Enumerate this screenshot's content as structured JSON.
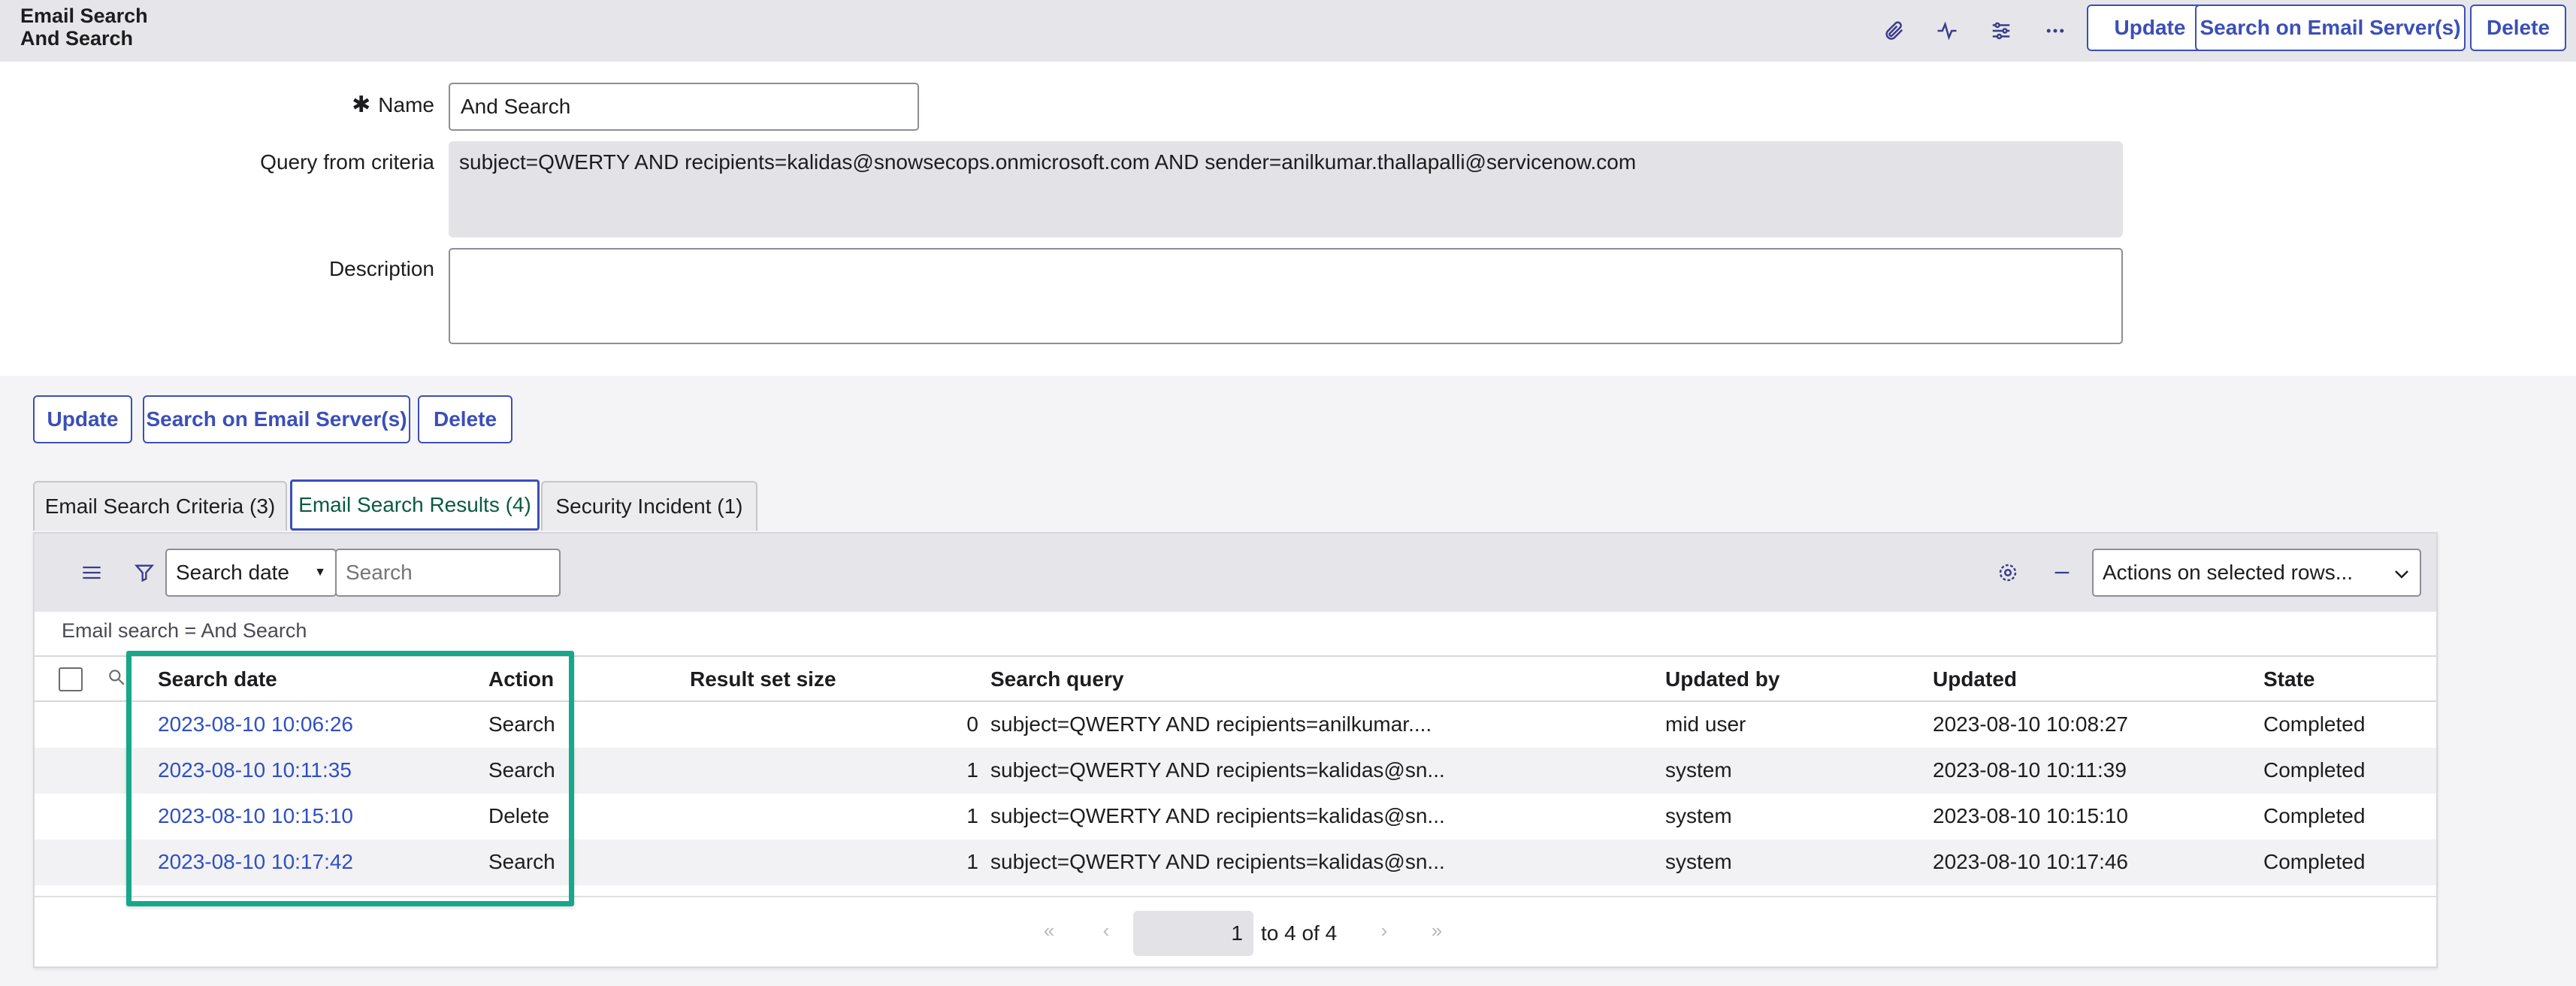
{
  "header": {
    "title_line1": "Email Search",
    "title_line2": "And Search",
    "icons": [
      "paperclip-icon",
      "activity-icon",
      "sliders-icon",
      "more-icon"
    ],
    "buttons": {
      "update": "Update",
      "search_servers": "Search on Email Server(s)",
      "delete": "Delete"
    }
  },
  "form": {
    "name_label": "Name",
    "name_required_mark": "✱",
    "name_value": "And Search",
    "query_label": "Query from criteria",
    "query_value": "subject=QWERTY AND recipients=kalidas@snowsecops.onmicrosoft.com AND sender=anilkumar.thallapalli@servicenow.com",
    "description_label": "Description",
    "description_value": ""
  },
  "actions": {
    "update": "Update",
    "search_servers": "Search on Email Server(s)",
    "delete": "Delete"
  },
  "tabs": [
    {
      "label": "Email Search Criteria (3)"
    },
    {
      "label": "Email Search Results (4)"
    },
    {
      "label": "Security Incident (1)"
    }
  ],
  "related_list": {
    "search_field": "Search date",
    "search_placeholder": "Search",
    "actions_select": "Actions on selected rows...",
    "breadcrumb": "Email search = And Search",
    "columns": [
      "Search date",
      "Action",
      "Result set size",
      "Search query",
      "Updated by",
      "Updated",
      "State"
    ],
    "rows": [
      {
        "search_date": "2023-08-10 10:06:26",
        "action": "Search",
        "result_size": "0",
        "query": "subject=QWERTY AND recipients=anilkumar....",
        "updated_by": "mid user",
        "updated": "2023-08-10 10:08:27",
        "state": "Completed"
      },
      {
        "search_date": "2023-08-10 10:11:35",
        "action": "Search",
        "result_size": "1",
        "query": "subject=QWERTY AND recipients=kalidas@sn...",
        "updated_by": "system",
        "updated": "2023-08-10 10:11:39",
        "state": "Completed"
      },
      {
        "search_date": "2023-08-10 10:15:10",
        "action": "Delete",
        "result_size": "1",
        "query": "subject=QWERTY AND recipients=kalidas@sn...",
        "updated_by": "system",
        "updated": "2023-08-10 10:15:10",
        "state": "Completed"
      },
      {
        "search_date": "2023-08-10 10:17:42",
        "action": "Search",
        "result_size": "1",
        "query": "subject=QWERTY AND recipients=kalidas@sn...",
        "updated_by": "system",
        "updated": "2023-08-10 10:17:46",
        "state": "Completed"
      }
    ],
    "pager": {
      "current": "1",
      "range_text": "to 4 of 4"
    }
  },
  "colors": {
    "accent": "#3b4fb8",
    "link": "#2f4fc4",
    "highlight": "#17a78b",
    "header_bg": "#e6e6ea"
  }
}
